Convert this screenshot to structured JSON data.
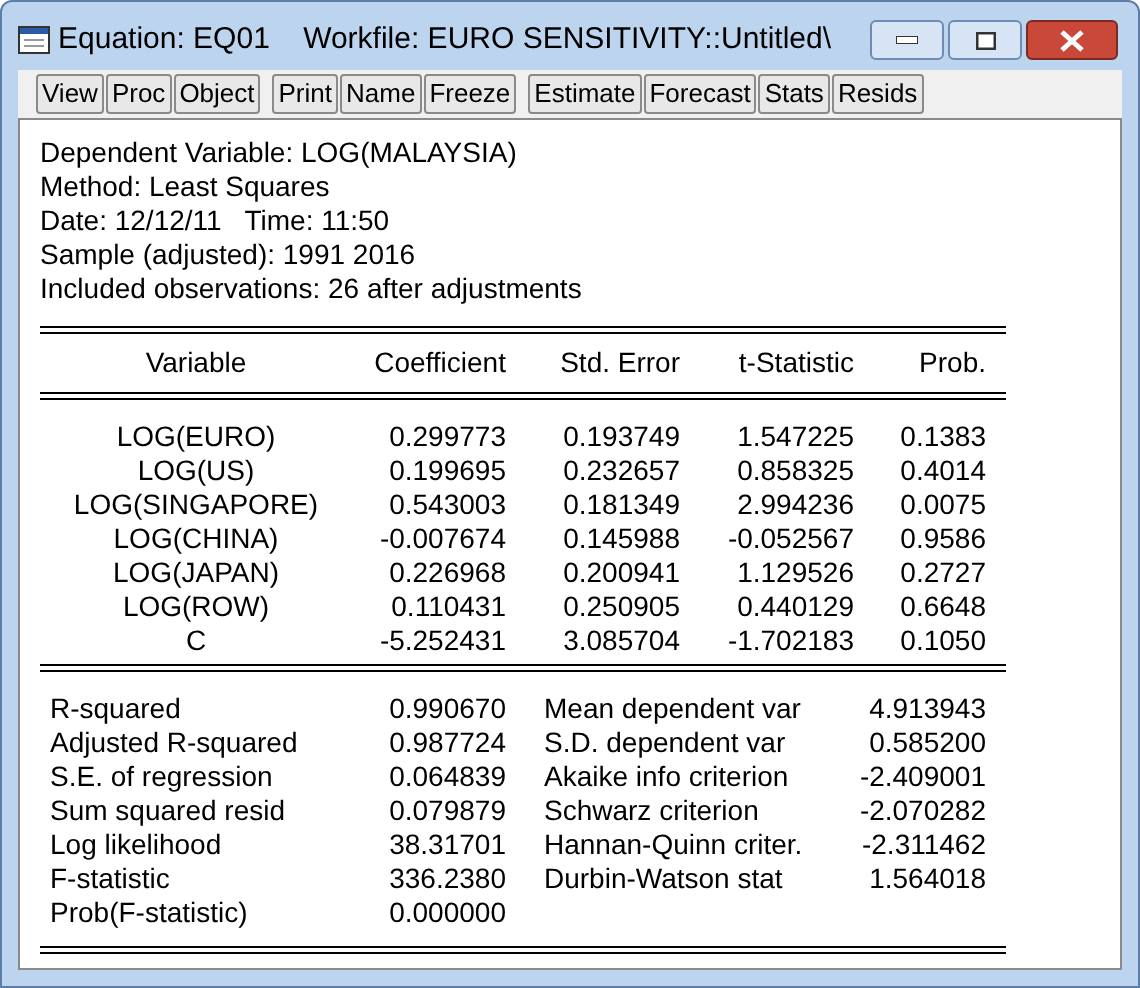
{
  "window": {
    "title": "Equation: EQ01    Workfile: EURO SENSITIVITY::Untitled\\"
  },
  "toolbar": [
    [
      "View",
      "Proc",
      "Object"
    ],
    [
      "Print",
      "Name",
      "Freeze"
    ],
    [
      "Estimate",
      "Forecast",
      "Stats",
      "Resids"
    ]
  ],
  "header_lines": [
    "Dependent Variable: LOG(MALAYSIA)",
    "Method: Least Squares",
    "Date: 12/12/11   Time: 11:50",
    "Sample (adjusted): 1991 2016",
    "Included observations: 26 after adjustments"
  ],
  "table": {
    "columns": [
      "Variable",
      "Coefficient",
      "Std. Error",
      "t-Statistic",
      "Prob."
    ],
    "rows": [
      [
        "LOG(EURO)",
        "0.299773",
        "0.193749",
        "1.547225",
        "0.1383"
      ],
      [
        "LOG(US)",
        "0.199695",
        "0.232657",
        "0.858325",
        "0.4014"
      ],
      [
        "LOG(SINGAPORE)",
        "0.543003",
        "0.181349",
        "2.994236",
        "0.0075"
      ],
      [
        "LOG(CHINA)",
        "-0.007674",
        "0.145988",
        "-0.052567",
        "0.9586"
      ],
      [
        "LOG(JAPAN)",
        "0.226968",
        "0.200941",
        "1.129526",
        "0.2727"
      ],
      [
        "LOG(ROW)",
        "0.110431",
        "0.250905",
        "0.440129",
        "0.6648"
      ],
      [
        "C",
        "-5.252431",
        "3.085704",
        "-1.702183",
        "0.1050"
      ]
    ]
  },
  "statistics": [
    [
      "R-squared",
      "0.990670",
      "Mean dependent var",
      "4.913943"
    ],
    [
      "Adjusted R-squared",
      "0.987724",
      "S.D. dependent var",
      "0.585200"
    ],
    [
      "S.E. of regression",
      "0.064839",
      "Akaike info criterion",
      "-2.409001"
    ],
    [
      "Sum squared resid",
      "0.079879",
      "Schwarz criterion",
      "-2.070282"
    ],
    [
      "Log likelihood",
      "38.31701",
      "Hannan-Quinn criter.",
      "-2.311462"
    ],
    [
      "F-statistic",
      "336.2380",
      "Durbin-Watson stat",
      "1.564018"
    ],
    [
      "Prob(F-statistic)",
      "0.000000"
    ]
  ]
}
